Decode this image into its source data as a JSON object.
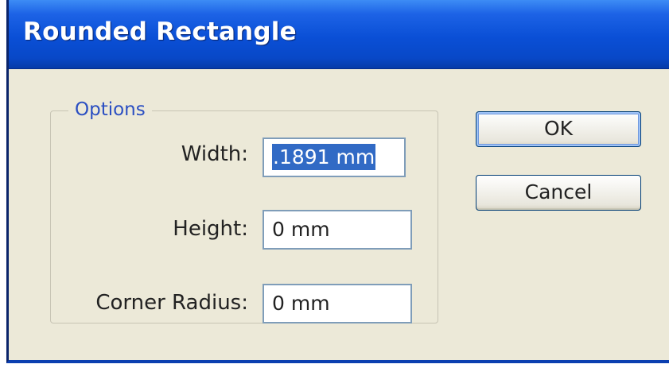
{
  "window": {
    "title": "Rounded Rectangle"
  },
  "options": {
    "legend": "Options",
    "width": {
      "label": "Width:",
      "value": ".1891 mm",
      "value_selected": true
    },
    "height": {
      "label": "Height:",
      "value": "0 mm"
    },
    "corner_radius": {
      "label": "Corner Radius:",
      "value": "0 mm"
    }
  },
  "buttons": {
    "ok": "OK",
    "cancel": "Cancel"
  },
  "colors": {
    "titlebar": "#0a4fd6",
    "dialog_bg": "#ece9d8",
    "legend_text": "#2b4fc2",
    "selection": "#316ac5"
  }
}
